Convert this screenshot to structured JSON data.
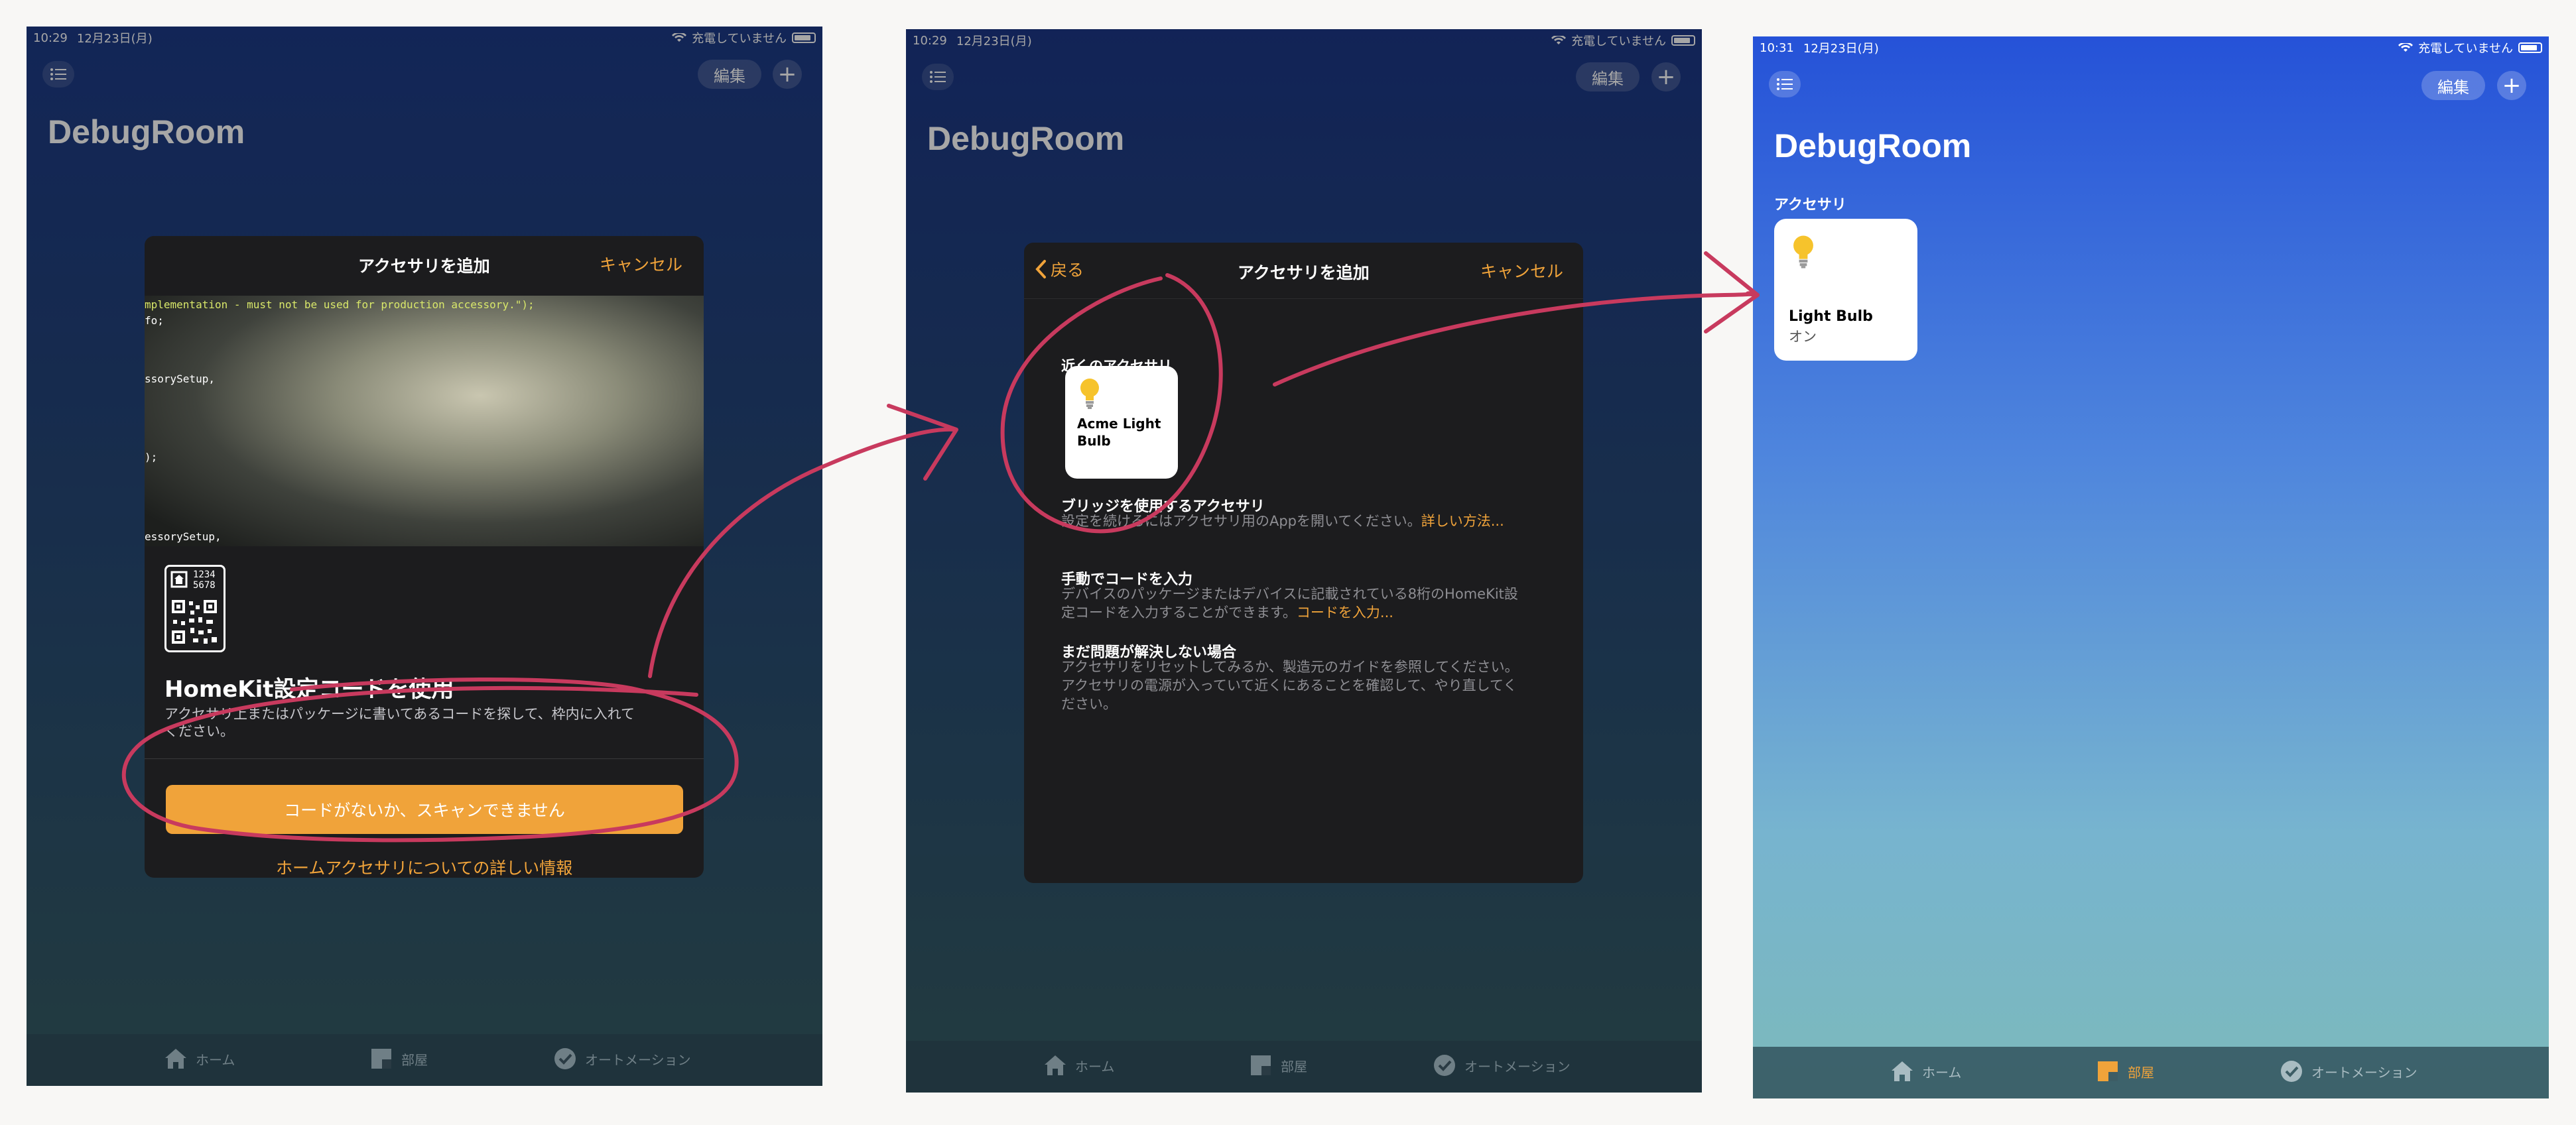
{
  "screen1": {
    "time": "10:29",
    "date": "12月23日(月)",
    "charging": "充電していません",
    "edit": "編集",
    "plus": "+",
    "room": "DebugRoom",
    "sheet_title": "アクセサリを追加",
    "cancel": "キャンセル",
    "scan_lines": [
      "mplementation - must not be used for production accessory.\");",
      "fo;",
      "ssorySetup,",
      ");",
      "essorySetup,"
    ],
    "qr_digits": [
      "1234",
      "5678"
    ],
    "heading": "HomeKit設定コードを使用",
    "instruction": "アクセサリ上またはパッケージに書いてあるコードを探して、枠内に入れて",
    "instruction2": "ください。",
    "no_code_button": "コードがないか、スキャンできません",
    "more_info": "ホームアクセサリについての詳しい情報",
    "tabs": [
      "ホーム",
      "部屋",
      "オートメーション"
    ]
  },
  "screen2": {
    "time": "10:29",
    "date": "12月23日(月)",
    "charging": "充電していません",
    "edit": "編集",
    "plus": "+",
    "room": "DebugRoom",
    "back": "戻る",
    "sheet_title": "アクセサリを追加",
    "cancel": "キャンセル",
    "nearby_label": "近くのアクセサリ",
    "accessory_name_1": "Acme Light",
    "accessory_name_2": "Bulb",
    "bridge_heading": "ブリッジを使用するアクセサリ",
    "bridge_text": "設定を続けるにはアクセサリ用のAppを開いてください。",
    "bridge_link": "詳しい方法...",
    "manual_heading": "手動でコードを入力",
    "manual_text_1": "デバイスのパッケージまたはデバイスに記載されている8桁のHomeKit設",
    "manual_text_2": "定コードを入力することができます。",
    "manual_link": "コードを入力...",
    "unresolved_heading": "まだ問題が解決しない場合",
    "unresolved_text_1": "アクセサリをリセットしてみるか、製造元のガイドを参照してください。",
    "unresolved_text_2": "アクセサリの電源が入っていて近くにあることを確認して、やり直してく",
    "unresolved_text_3": "ださい。",
    "tabs": [
      "ホーム",
      "部屋",
      "オートメーション"
    ]
  },
  "screen3": {
    "time": "10:31",
    "date": "12月23日(月)",
    "charging": "充電していません",
    "edit": "編集",
    "plus": "+",
    "room": "DebugRoom",
    "section": "アクセサリ",
    "tile_name": "Light Bulb",
    "tile_status": "オン",
    "tabs": [
      "ホーム",
      "部屋",
      "オートメーション"
    ],
    "active_tab": "部屋"
  },
  "colors": {
    "accent": "#f0a33a",
    "annotation": "#c83a5e"
  }
}
